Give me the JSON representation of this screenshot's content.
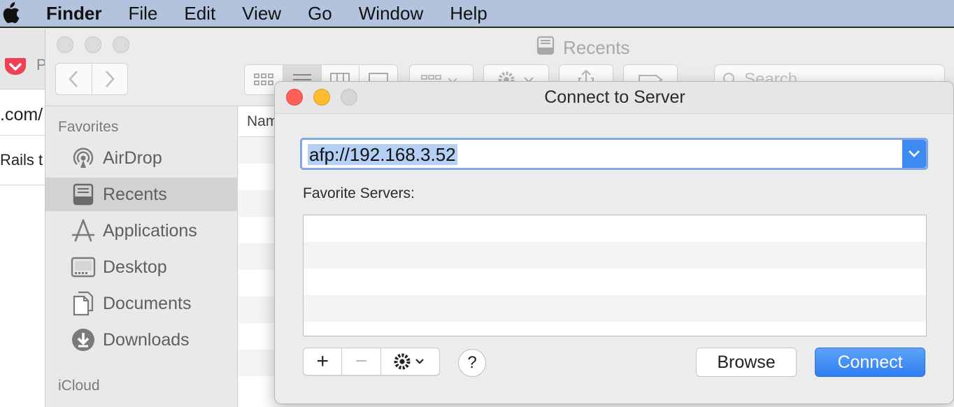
{
  "menubar": {
    "app_name": "Finder",
    "items": [
      "File",
      "Edit",
      "View",
      "Go",
      "Window",
      "Help"
    ]
  },
  "browser": {
    "tab_title_partial": "P",
    "url_partial": ".com/",
    "bookmark_partial": "Rails t"
  },
  "finder": {
    "title": "Recents",
    "search_placeholder": "Search",
    "column_header": "Nam",
    "sidebar": {
      "favorites_header": "Favorites",
      "items": [
        {
          "label": "AirDrop",
          "icon": "airdrop-icon"
        },
        {
          "label": "Recents",
          "icon": "recents-icon",
          "selected": true
        },
        {
          "label": "Applications",
          "icon": "applications-icon"
        },
        {
          "label": "Desktop",
          "icon": "desktop-icon"
        },
        {
          "label": "Documents",
          "icon": "documents-icon"
        },
        {
          "label": "Downloads",
          "icon": "downloads-icon"
        }
      ],
      "icloud_header": "iCloud"
    }
  },
  "dialog": {
    "title": "Connect to Server",
    "server_address": "afp://192.168.3.52",
    "favorites_label": "Favorite Servers:",
    "favorite_servers": [],
    "add_label": "+",
    "remove_label": "−",
    "help_label": "?",
    "browse_label": "Browse",
    "connect_label": "Connect"
  },
  "colors": {
    "accent": "#3d8bf0",
    "selection": "#b5d0f5",
    "close": "#fe5f57",
    "minimize": "#febc2e"
  }
}
